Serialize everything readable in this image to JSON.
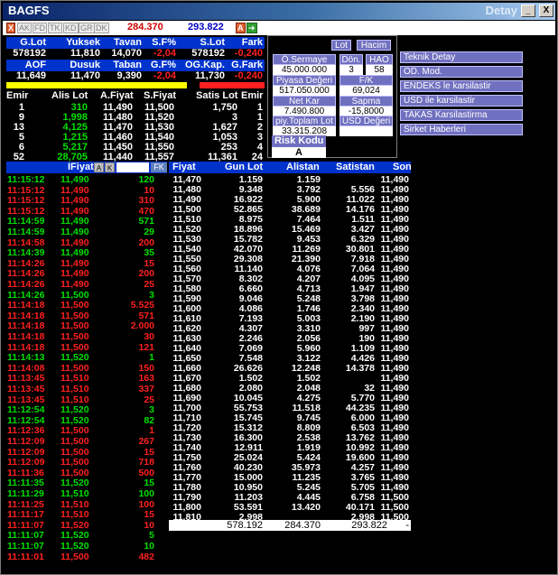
{
  "window": {
    "title": "BAGFS",
    "right_title": "Detay",
    "min": "_",
    "max": "□",
    "close": "X"
  },
  "toolbar": {
    "tools": [
      "AK",
      "FD",
      "TK",
      "KD",
      "GR",
      "DK"
    ],
    "value_red": "284.370",
    "value_blue": "293.822",
    "a_label": "A"
  },
  "summary": {
    "row1_headers": [
      "G.Lot",
      "Yuksek",
      "Tavan",
      "S.F%",
      "S.Lot",
      "Fark"
    ],
    "row1_values": [
      "578192",
      "11,810",
      "14,070",
      "-2,04",
      "578192",
      "-0,240"
    ],
    "row2_headers": [
      "AOF",
      "Dusuk",
      "Taban",
      "G.F%",
      "OG.Kap.",
      "G.Fark"
    ],
    "row2_values": [
      "11,649",
      "11,470",
      "9,390",
      "-2,04",
      "11,730",
      "-0,240"
    ]
  },
  "orders": {
    "headers": [
      "Emir",
      "Alis Lot",
      "A.Fiyat",
      "S.Fiyat",
      "Satis Lot",
      "Emir"
    ],
    "rows": [
      [
        "1",
        "310",
        "11,490",
        "11,500",
        "1,750",
        "1"
      ],
      [
        "9",
        "1,998",
        "11,480",
        "11,520",
        "3",
        "1"
      ],
      [
        "13",
        "4,125",
        "11,470",
        "11,530",
        "1,627",
        "2"
      ],
      [
        "5",
        "1,215",
        "11,460",
        "11,540",
        "1,053",
        "3"
      ],
      [
        "6",
        "5,217",
        "11,450",
        "11,550",
        "253",
        "4"
      ],
      [
        "52",
        "28,705",
        "11,440",
        "11,557",
        "11,361",
        "24"
      ]
    ]
  },
  "info": {
    "lot": "Lot",
    "hacim": "Hacim",
    "o_sermaye_label": "Ö.Sermaye",
    "o_sermaye": "45.000.000",
    "don_label": "Dön.",
    "don": "3",
    "hao_label": "HAO",
    "hao": "58",
    "piyasa_label": "Piyasa Değeri",
    "piyasa": "517.050.000",
    "fk_label": "F/K",
    "fk": "69,024",
    "netkar_label": "Net Kar",
    "netkar": "7.490.800",
    "sapma_label": "Sapma",
    "sapma": "-15,8000",
    "piy_toplam_label": "piy.Toplam Lot",
    "piy_toplam": "33.315.208",
    "usd_label": "USD Değeri",
    "usd": "",
    "risk_label": "Risk Kodu",
    "risk": "A"
  },
  "links": [
    "Teknik Detay",
    "OD. Mod.",
    "ENDEKS le karsilastir",
    "USD ile karsilastir",
    "TAKAS Karsilastirma",
    "Sirket Haberleri"
  ],
  "trades_header": {
    "fiyat": "IFiyat",
    "a": "A",
    "k": "K",
    "fk": "FK"
  },
  "trades": [
    [
      "11:15:12",
      "11,490",
      "120",
      "g"
    ],
    [
      "11:15:12",
      "11,490",
      "10",
      "r"
    ],
    [
      "11:15:12",
      "11,490",
      "310",
      "r"
    ],
    [
      "11:15:12",
      "11,490",
      "470",
      "r"
    ],
    [
      "11:14:59",
      "11,490",
      "571",
      "g"
    ],
    [
      "11:14:59",
      "11,490",
      "29",
      "g"
    ],
    [
      "11:14:58",
      "11,490",
      "200",
      "r"
    ],
    [
      "11:14:39",
      "11,490",
      "35",
      "g"
    ],
    [
      "11:14:26",
      "11,490",
      "15",
      "r"
    ],
    [
      "11:14:26",
      "11,490",
      "200",
      "r"
    ],
    [
      "11:14:26",
      "11,490",
      "25",
      "r"
    ],
    [
      "11:14:26",
      "11,500",
      "3",
      "g"
    ],
    [
      "11:14:18",
      "11,500",
      "5.525",
      "r"
    ],
    [
      "11:14:18",
      "11,500",
      "571",
      "r"
    ],
    [
      "11:14:18",
      "11,500",
      "2.000",
      "r"
    ],
    [
      "11:14:18",
      "11,500",
      "30",
      "r"
    ],
    [
      "11:14:18",
      "11,500",
      "121",
      "r"
    ],
    [
      "11:14:13",
      "11,520",
      "1",
      "g"
    ],
    [
      "11:14:08",
      "11,500",
      "150",
      "r"
    ],
    [
      "11:13:45",
      "11,510",
      "163",
      "r"
    ],
    [
      "11:13:45",
      "11,510",
      "337",
      "r"
    ],
    [
      "11:13:45",
      "11,510",
      "25",
      "r"
    ],
    [
      "11:12:54",
      "11,520",
      "3",
      "g"
    ],
    [
      "11:12:54",
      "11,520",
      "82",
      "g"
    ],
    [
      "11:12:36",
      "11,500",
      "1",
      "r"
    ],
    [
      "11:12:09",
      "11,500",
      "267",
      "r"
    ],
    [
      "11:12:09",
      "11,500",
      "15",
      "r"
    ],
    [
      "11:12:09",
      "11,500",
      "718",
      "r"
    ],
    [
      "11:11:36",
      "11,500",
      "500",
      "r"
    ],
    [
      "11:11:35",
      "11,520",
      "15",
      "g"
    ],
    [
      "11:11:29",
      "11,510",
      "100",
      "g"
    ],
    [
      "11:11:25",
      "11,510",
      "100",
      "r"
    ],
    [
      "11:11:17",
      "11,510",
      "15",
      "r"
    ],
    [
      "11:11:07",
      "11,520",
      "10",
      "r"
    ],
    [
      "11:11:07",
      "11,520",
      "5",
      "g"
    ],
    [
      "11:11:07",
      "11,520",
      "10",
      "g"
    ],
    [
      "11:11:01",
      "11,500",
      "482",
      "r"
    ]
  ],
  "depth_headers": [
    "Fiyat",
    "Gun Lot",
    "Alistan",
    "Satistan",
    "Son"
  ],
  "depth": [
    [
      "11,470",
      "1.159",
      "1.159",
      "",
      "11,490"
    ],
    [
      "11,480",
      "9.348",
      "3.792",
      "5.556",
      "11,490"
    ],
    [
      "11,490",
      "16.922",
      "5.900",
      "11.022",
      "11,490"
    ],
    [
      "11,500",
      "52.865",
      "38.689",
      "14.176",
      "11,490"
    ],
    [
      "11,510",
      "8.975",
      "7.464",
      "1.511",
      "11,490"
    ],
    [
      "11,520",
      "18.896",
      "15.469",
      "3.427",
      "11,490"
    ],
    [
      "11,530",
      "15.782",
      "9.453",
      "6.329",
      "11,490"
    ],
    [
      "11,540",
      "42.070",
      "11.269",
      "30.801",
      "11,490"
    ],
    [
      "11,550",
      "29.308",
      "21.390",
      "7.918",
      "11,490"
    ],
    [
      "11,560",
      "11.140",
      "4.076",
      "7.064",
      "11,490"
    ],
    [
      "11,570",
      "8.302",
      "4.207",
      "4.095",
      "11,490"
    ],
    [
      "11,580",
      "6.660",
      "4.713",
      "1.947",
      "11,490"
    ],
    [
      "11,590",
      "9.046",
      "5.248",
      "3.798",
      "11,490"
    ],
    [
      "11,600",
      "4.086",
      "1.746",
      "2.340",
      "11,490"
    ],
    [
      "11,610",
      "7.193",
      "5.003",
      "2.190",
      "11,490"
    ],
    [
      "11,620",
      "4.307",
      "3.310",
      "997",
      "11,490"
    ],
    [
      "11,630",
      "2.246",
      "2.056",
      "190",
      "11,490"
    ],
    [
      "11,640",
      "7.069",
      "5.960",
      "1.109",
      "11,490"
    ],
    [
      "11,650",
      "7.548",
      "3.122",
      "4.426",
      "11,490"
    ],
    [
      "11,660",
      "26.626",
      "12.248",
      "14.378",
      "11,490"
    ],
    [
      "11,670",
      "1.502",
      "1.502",
      "",
      "11,490"
    ],
    [
      "11,680",
      "2.080",
      "2.048",
      "32",
      "11,490"
    ],
    [
      "11,690",
      "10.045",
      "4.275",
      "5.770",
      "11,490"
    ],
    [
      "11,700",
      "55.753",
      "11.518",
      "44.235",
      "11,490"
    ],
    [
      "11,710",
      "15.745",
      "9.745",
      "6.000",
      "11,490"
    ],
    [
      "11,720",
      "15.312",
      "8.809",
      "6.503",
      "11,490"
    ],
    [
      "11,730",
      "16.300",
      "2.538",
      "13.762",
      "11,490"
    ],
    [
      "11,740",
      "12.911",
      "1.919",
      "10.992",
      "11,490"
    ],
    [
      "11,750",
      "25.024",
      "5.424",
      "19.600",
      "11,490"
    ],
    [
      "11,760",
      "40.230",
      "35.973",
      "4.257",
      "11,490"
    ],
    [
      "11,770",
      "15.000",
      "11.235",
      "3.765",
      "11,490"
    ],
    [
      "11,780",
      "10.950",
      "5.245",
      "5.705",
      "11,490"
    ],
    [
      "11,790",
      "11.203",
      "4.445",
      "6.758",
      "11,500"
    ],
    [
      "11,800",
      "53.591",
      "13.420",
      "40.171",
      "11,500"
    ],
    [
      "11,810",
      "2.998",
      "",
      "2.998",
      "11,500"
    ]
  ],
  "depth_totals": [
    "578.192",
    "284.370",
    "293.822",
    "-"
  ],
  "colors": {
    "header_blue": "#0033cc",
    "up": "#00e000",
    "down": "#ff2020",
    "panel_btn": "#7070c0"
  }
}
